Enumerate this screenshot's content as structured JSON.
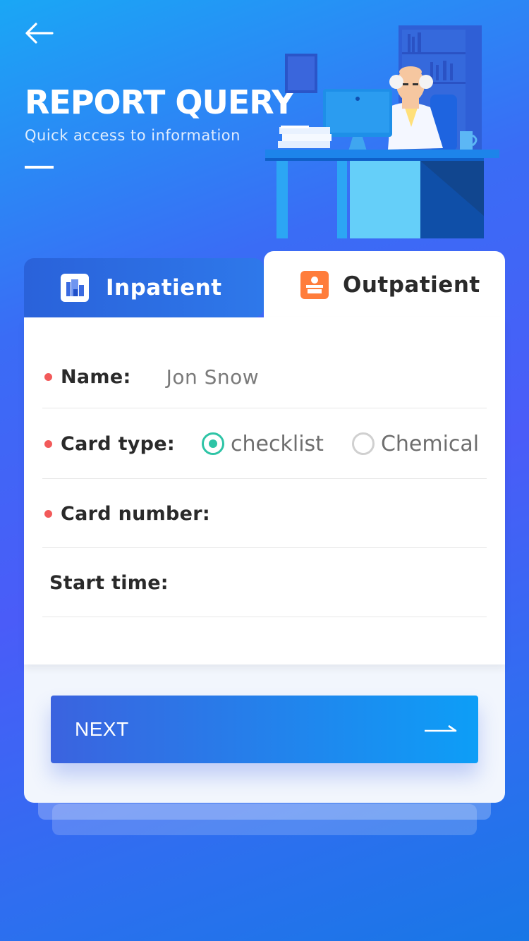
{
  "header": {
    "title": "REPORT QUERY",
    "subtitle": "Quick access to information"
  },
  "tabs": [
    {
      "label": "Inpatient",
      "icon": "building-icon",
      "active": false
    },
    {
      "label": "Outpatient",
      "icon": "doctor-icon",
      "active": true
    }
  ],
  "form": {
    "name_label": "Name:",
    "name_value": "Jon Snow",
    "card_type_label": "Card type:",
    "card_type_options": [
      {
        "label": "checklist",
        "selected": true
      },
      {
        "label": "Chemical",
        "selected": false
      }
    ],
    "card_number_label": "Card number:",
    "start_time_label": "Start time:"
  },
  "actions": {
    "next_label": "NEXT"
  },
  "colors": {
    "accent_blue": "#2a6fe0",
    "required_dot": "#f25a5a",
    "radio_selected": "#2ec4a6",
    "outpatient_icon": "#ff7d3b"
  }
}
